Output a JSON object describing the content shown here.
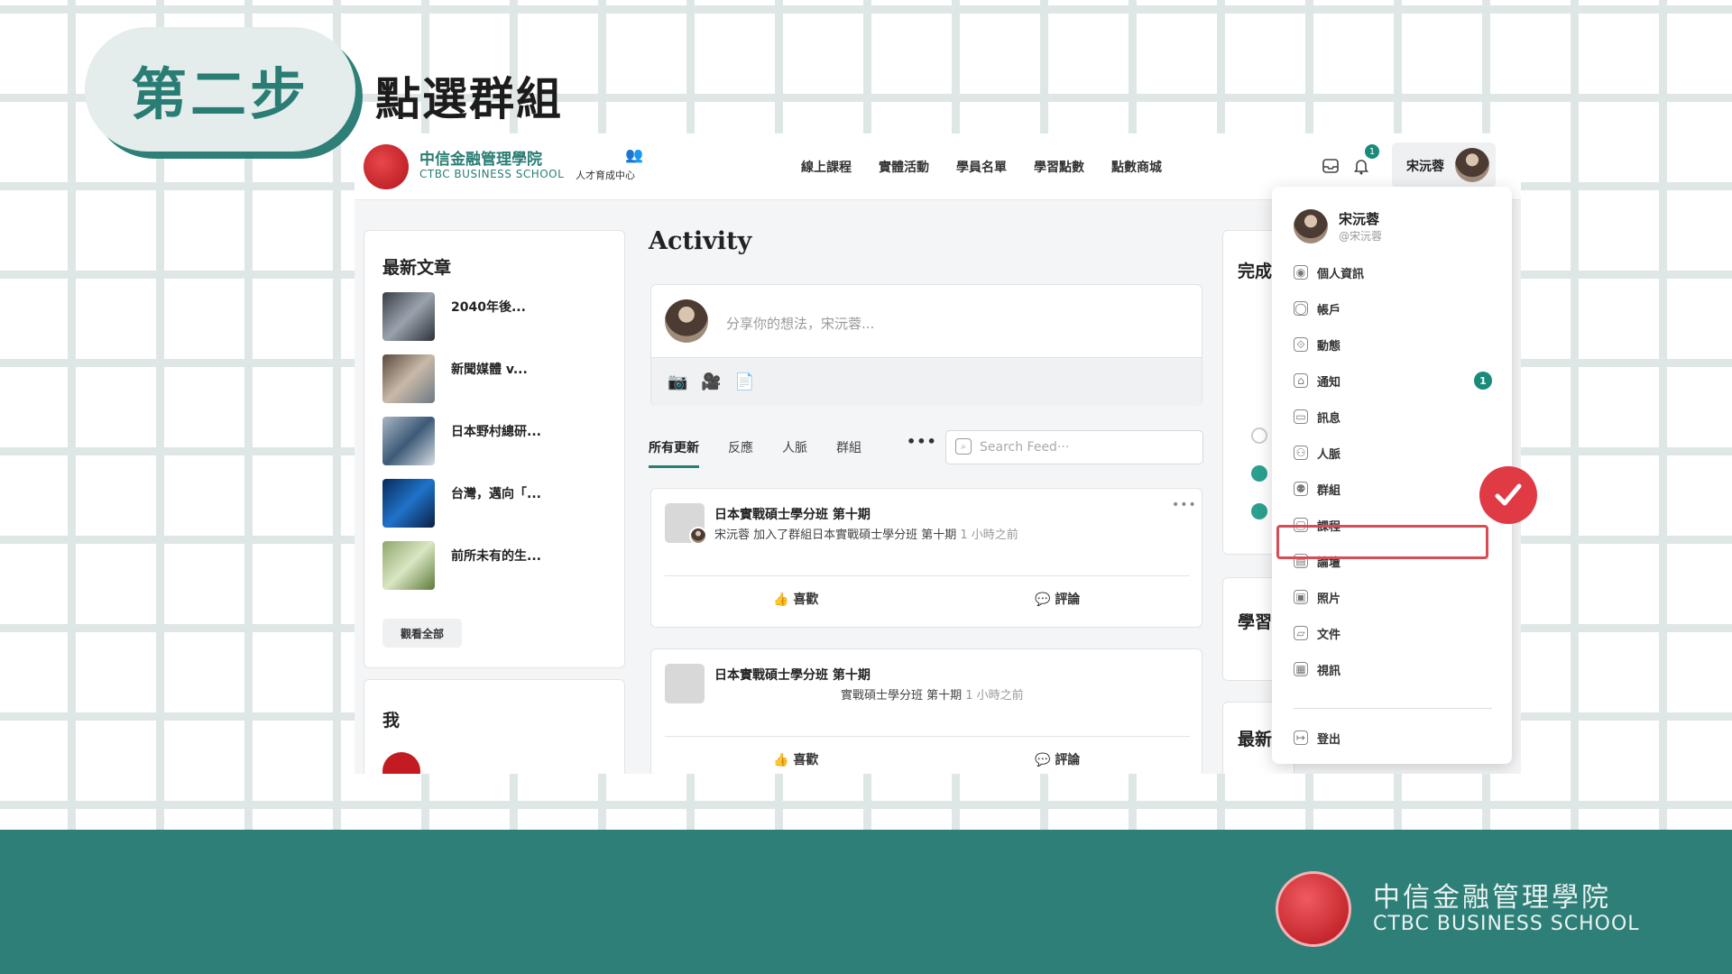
{
  "step": {
    "label": "第二步",
    "title": "點選群組"
  },
  "site": {
    "logo_zh": "中信金融管理學院",
    "logo_en": "CTBC BUSINESS SCHOOL",
    "logo_sub": "人才育成中心",
    "nav": [
      "線上課程",
      "實體活動",
      "學員名單",
      "學習點數",
      "點數商城"
    ],
    "bell_count": "1",
    "user_name": "宋沅蓉"
  },
  "left": {
    "heading": "最新文章",
    "articles": [
      "2040年後...",
      "新聞媒體 v...",
      "日本野村總研...",
      "台灣，邁向「...",
      "前所未有的生..."
    ],
    "view_all": "觀看全部",
    "partial_heading": "我"
  },
  "activity": {
    "title": "Activity",
    "composer_placeholder": "分享你的想法，宋沅蓉...",
    "tabs": [
      "所有更新",
      "反應",
      "人脈",
      "群組"
    ],
    "more": "•••",
    "search_placeholder": "Search Feed···",
    "feed": [
      {
        "group": "日本實戰碩士學分班 第十期",
        "line": "宋沅蓉 加入了群組日本實戰碩士學分班 第十期",
        "time": "1 小時之前",
        "like": "喜歡",
        "comment": "評論"
      },
      {
        "group": "日本實戰碩士學分班 第十期",
        "line": "實戰碩士學分班 第十期",
        "time": "1 小時之前",
        "like": "喜歡",
        "comment": "評論"
      }
    ]
  },
  "right_partial": {
    "c1": "完成",
    "c2": "學習",
    "c3": "最新"
  },
  "dropdown": {
    "name": "宋沅蓉",
    "handle": "@宋沅蓉",
    "items": [
      {
        "label": "個人資訊",
        "icon": "profile-icon"
      },
      {
        "label": "帳戶",
        "icon": "account-icon"
      },
      {
        "label": "動態",
        "icon": "activity-icon"
      },
      {
        "label": "通知",
        "icon": "bell-icon",
        "count": "1"
      },
      {
        "label": "訊息",
        "icon": "inbox-icon"
      },
      {
        "label": "人脈",
        "icon": "connections-icon"
      },
      {
        "label": "群組",
        "icon": "groups-icon"
      },
      {
        "label": "課程",
        "icon": "course-icon"
      },
      {
        "label": "論壇",
        "icon": "forum-icon"
      },
      {
        "label": "照片",
        "icon": "photo-icon"
      },
      {
        "label": "文件",
        "icon": "document-icon"
      },
      {
        "label": "視訊",
        "icon": "video-icon"
      }
    ],
    "logout": "登出"
  },
  "footer": {
    "zh": "中信金融管理學院",
    "en": "CTBC BUSINESS SCHOOL"
  },
  "colors": {
    "teal": "#2d7f77",
    "highlight": "#d94b55",
    "badge": "#1a8a7a"
  }
}
